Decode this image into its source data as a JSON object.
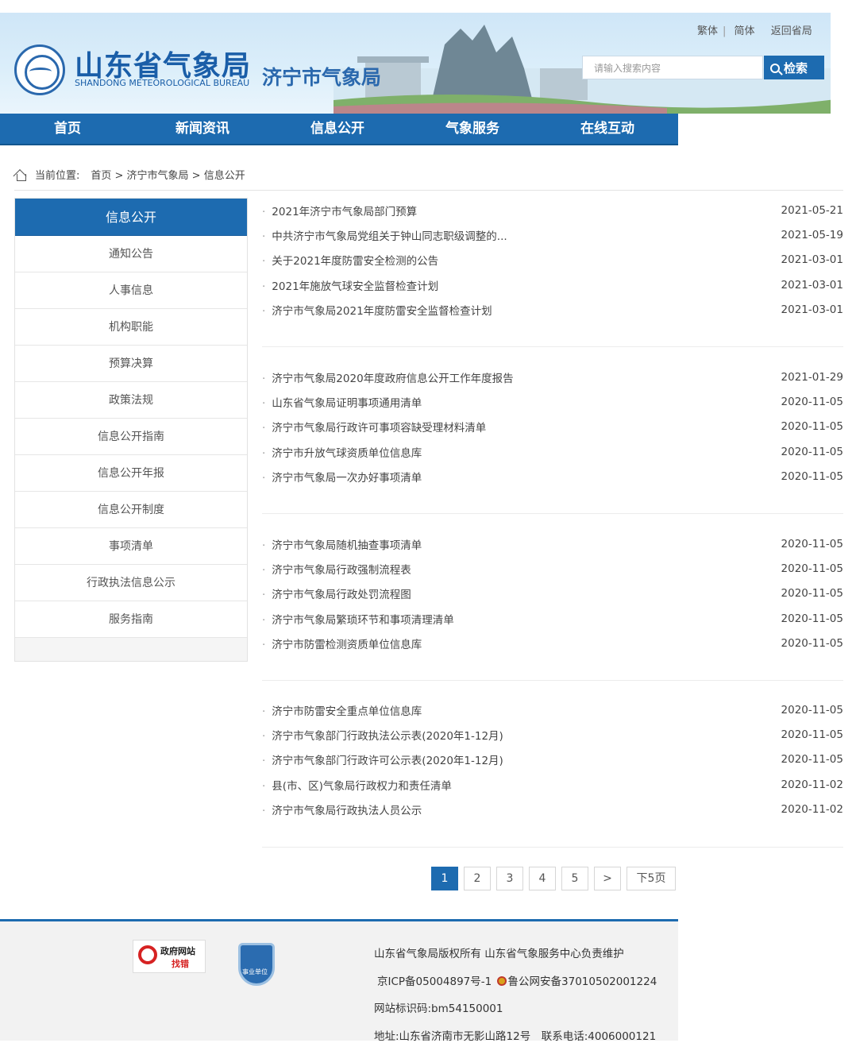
{
  "header": {
    "title": "山东省气象局",
    "subtitle": "SHANDONG METEOROLOGICAL BUREAU",
    "city": "济宁市气象局",
    "toplinks": [
      "繁体",
      "简体",
      "返回省局"
    ],
    "search_placeholder": "请输入搜索内容",
    "search_button": "检索"
  },
  "nav": [
    "首页",
    "新闻资讯",
    "信息公开",
    "气象服务",
    "在线互动"
  ],
  "breadcrumb": {
    "label": "当前位置:",
    "path": "首页 > 济宁市气象局 > 信息公开"
  },
  "sidebar": {
    "active": "信息公开",
    "items": [
      "通知公告",
      "人事信息",
      "机构职能",
      "预算决算",
      "政策法规",
      "信息公开指南",
      "信息公开年报",
      "信息公开制度",
      "事项清单",
      "行政执法信息公示",
      "服务指南"
    ]
  },
  "articles": [
    [
      {
        "title": "2021年济宁市气象局部门预算",
        "date": "2021-05-21"
      },
      {
        "title": "中共济宁市气象局党组关于钟山同志职级调整的...",
        "date": "2021-05-19"
      },
      {
        "title": "关于2021年度防雷安全检测的公告",
        "date": "2021-03-01"
      },
      {
        "title": "2021年施放气球安全监督检查计划",
        "date": "2021-03-01"
      },
      {
        "title": "济宁市气象局2021年度防雷安全监督检查计划",
        "date": "2021-03-01"
      }
    ],
    [
      {
        "title": "济宁市气象局2020年度政府信息公开工作年度报告",
        "date": "2021-01-29"
      },
      {
        "title": "山东省气象局证明事项通用清单",
        "date": "2020-11-05"
      },
      {
        "title": "济宁市气象局行政许可事项容缺受理材料清单",
        "date": "2020-11-05"
      },
      {
        "title": "济宁市升放气球资质单位信息库",
        "date": "2020-11-05"
      },
      {
        "title": "济宁市气象局一次办好事项清单",
        "date": "2020-11-05"
      }
    ],
    [
      {
        "title": "济宁市气象局随机抽查事项清单",
        "date": "2020-11-05"
      },
      {
        "title": "济宁市气象局行政强制流程表",
        "date": "2020-11-05"
      },
      {
        "title": "济宁市气象局行政处罚流程图",
        "date": "2020-11-05"
      },
      {
        "title": "济宁市气象局繁琐环节和事项清理清单",
        "date": "2020-11-05"
      },
      {
        "title": "济宁市防雷检测资质单位信息库",
        "date": "2020-11-05"
      }
    ],
    [
      {
        "title": "济宁市防雷安全重点单位信息库",
        "date": "2020-11-05"
      },
      {
        "title": "济宁市气象部门行政执法公示表(2020年1-12月)",
        "date": "2020-11-05"
      },
      {
        "title": "济宁市气象部门行政许可公示表(2020年1-12月)",
        "date": "2020-11-05"
      },
      {
        "title": "县(市、区)气象局行政权力和责任清单",
        "date": "2020-11-02"
      },
      {
        "title": "济宁市气象局行政执法人员公示",
        "date": "2020-11-02"
      }
    ]
  ],
  "pagination": {
    "pages": [
      "1",
      "2",
      "3",
      "4",
      "5"
    ],
    "next": ">",
    "next5": "下5页"
  },
  "footer": {
    "badge1_line1": "政府网站",
    "badge1_line2": "找错",
    "badge2": "事业单位",
    "copyright": "山东省气象局版权所有 山东省气象服务中心负责维护",
    "icp": "京ICP备05004897号-1",
    "police": "鲁公网安备37010502001224",
    "site_id": "网站标识码:bm54150001",
    "address": "地址:山东省济南市无影山路12号　联系电话:4006000121"
  },
  "colors": {
    "primary": "#1d6bb0"
  }
}
